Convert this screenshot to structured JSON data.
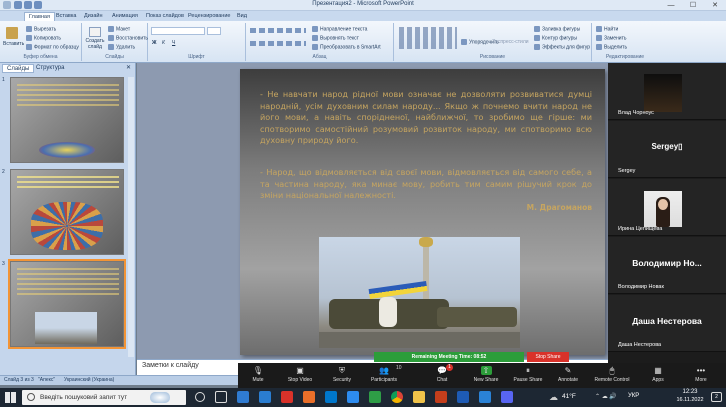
{
  "window": {
    "title": "Презентация2 - Microsoft PowerPoint",
    "minimize": "—",
    "maximize": "☐",
    "close": "✕"
  },
  "ribbon_tabs": [
    "Главная",
    "Вставка",
    "Дизайн",
    "Анимация",
    "Показ слайдов",
    "Рецензирование",
    "Вид"
  ],
  "ribbon": {
    "clipboard": {
      "paste": "Вставить",
      "cut": "Вырезать",
      "copy": "Копировать",
      "format": "Формат по образцу",
      "label": "Буфер обмена"
    },
    "slides": {
      "create": "Создать слайд",
      "layout": "Макет",
      "reset": "Восстановить",
      "delete": "Удалить",
      "label": "Слайды"
    },
    "font": {
      "label": "Шрифт",
      "bold": "Ж",
      "italic": "К",
      "underline": "Ч"
    },
    "paragraph": {
      "label": "Абзац",
      "direction": "Направление текста",
      "align": "Выровнять текст",
      "smartart": "Преобразовать в SmartArt"
    },
    "drawing": {
      "label": "Рисование",
      "arrange": "Упорядочить",
      "quickstyles": "Экспресс-стили",
      "fill": "Заливка фигуры",
      "outline": "Контур фигуры",
      "effects": "Эффекты для фигур"
    },
    "editing": {
      "label": "Редактирование",
      "find": "Найти",
      "replace": "Заменить",
      "select": "Выделить"
    }
  },
  "left_panel": {
    "tab_slides": "Слайды",
    "tab_structure": "Структура",
    "close": "✕",
    "slide_numbers": [
      "1",
      "2",
      "3"
    ]
  },
  "slide": {
    "para1": "- Не навчати народ рідної мови означає не дозволяти розвиватися думці народній, усім духовним силам народу... Якщо ж почнемо вчити народ не його мови, а навіть спорідненої, найближчої, то зробимо ще гірше: ми спотворимо самостійний розумовий розвиток народу, ми спотворимо всю духовну природу його.",
    "para2": "- Народ, що відмовляється від своєї мови, відмовляється від самого себе, а та частина народу, яка минає мову, робить тим самим рішучий крок до зміни національної належності.",
    "signature": "М. Драгоманов"
  },
  "notes": {
    "placeholder": "Заметки к слайду"
  },
  "status": {
    "slide": "Слайд 3 из 3",
    "theme": "\"Апекс\"",
    "language": "Украинский (Украина)"
  },
  "zoom": {
    "participants": [
      {
        "name": "Влад Чорноус"
      },
      {
        "name": "Sergey",
        "big": "Sergey▯"
      },
      {
        "name": "Ирина Цепищева"
      },
      {
        "name": "Володимир Новак",
        "big": "Володимир Но..."
      },
      {
        "name": "Даша Нестерова",
        "big": "Даша Нестерова"
      }
    ],
    "timer": "Remaining Meeting Time: 08:52",
    "stop_share": "Stop Share",
    "toolbar": [
      "Mute",
      "Stop Video",
      "Security",
      "Participants",
      "Chat",
      "New Share",
      "Pause Share",
      "Annotate",
      "Remote Control",
      "Apps",
      "More"
    ],
    "participants_count": "10",
    "chat_badge": "1"
  },
  "taskbar": {
    "search_placeholder": "Введіть пошуковий запит тут",
    "weather": "41°F",
    "language": "УКР",
    "time": "12:23",
    "date": "16.11.2022",
    "notification_count": "2"
  },
  "colors": {
    "accent": "#2c9d3a",
    "stop": "#d9322a",
    "slide_text": "#c6a560",
    "ribbon": "#dfe9f5"
  }
}
